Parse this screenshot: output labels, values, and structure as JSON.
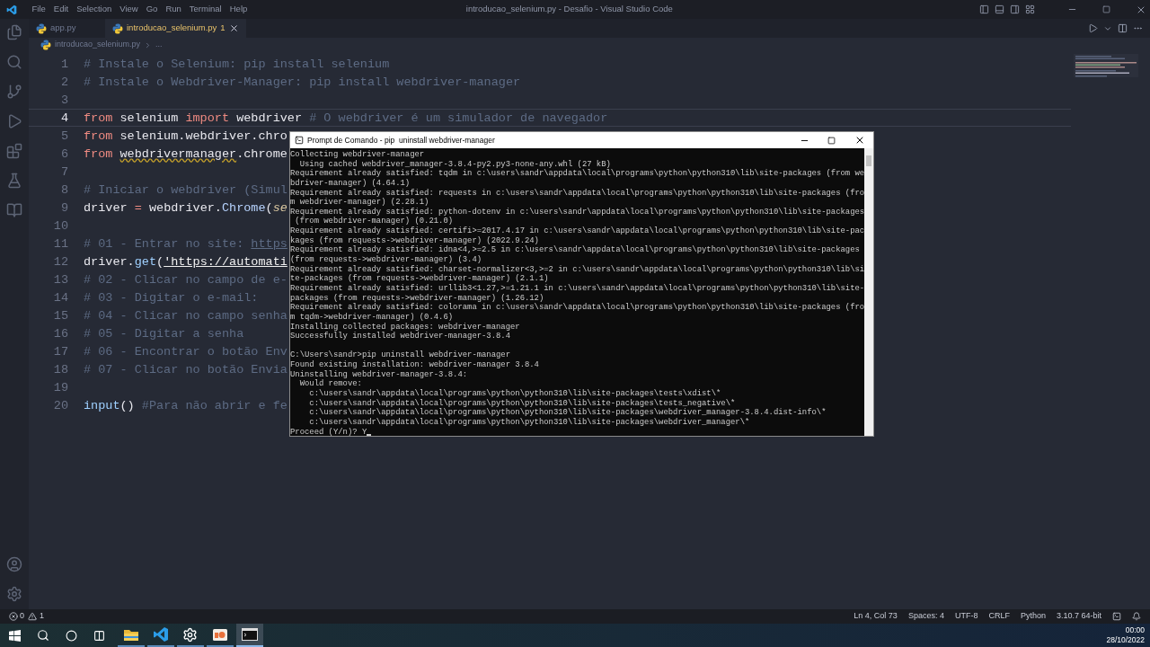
{
  "title_bar": {
    "menu": [
      "File",
      "Edit",
      "Selection",
      "View",
      "Go",
      "Run",
      "Terminal",
      "Help"
    ],
    "title": "introducao_selenium.py - Desafio - Visual Studio Code"
  },
  "tabs": [
    {
      "label": "app.py",
      "selected": false
    },
    {
      "label": "introducao_selenium.py",
      "badge": "1",
      "selected": true
    }
  ],
  "breadcrumb": {
    "file": "introducao_selenium.py",
    "rest": "..."
  },
  "editor": {
    "lines": [
      {
        "number": "1",
        "current": false,
        "tokens": [
          {
            "kind": "comment",
            "text": "# Instale o Selenium: pip install selenium"
          }
        ]
      },
      {
        "number": "2",
        "current": false,
        "tokens": [
          {
            "kind": "comment",
            "text": "# Instale o Webdriver-Manager: pip install webdriver-manager"
          }
        ]
      },
      {
        "number": "3",
        "current": false
      },
      {
        "number": "4",
        "current": true,
        "tokens": [
          {
            "kind": "keyword",
            "text": "from"
          },
          {
            "kind": "plain",
            "text": " selenium "
          },
          {
            "kind": "keyword",
            "text": "import"
          },
          {
            "kind": "plain",
            "text": " webdriver "
          },
          {
            "kind": "comment",
            "text": "# O webdriver é um simulador de navegador"
          }
        ]
      },
      {
        "number": "5",
        "current": false,
        "tokens": [
          {
            "kind": "keyword",
            "text": "from"
          },
          {
            "kind": "plain",
            "text": " selenium.webdriver.chro"
          }
        ]
      },
      {
        "number": "6",
        "current": false,
        "tokens": [
          {
            "kind": "keyword",
            "text": "from "
          },
          {
            "kind": "warning",
            "text": "webdrivermanager"
          },
          {
            "kind": "plain",
            "text": ".chrome"
          }
        ]
      },
      {
        "number": "7",
        "current": false
      },
      {
        "number": "8",
        "current": false,
        "tokens": [
          {
            "kind": "comment",
            "text": "# Iniciar o webdriver (Simul"
          }
        ]
      },
      {
        "number": "9",
        "current": false,
        "tokens": [
          {
            "kind": "plain",
            "text": "driver "
          },
          {
            "kind": "operator",
            "text": "="
          },
          {
            "kind": "plain",
            "text": " webdriver."
          },
          {
            "kind": "class",
            "text": "Chrome"
          },
          {
            "kind": "plain",
            "text": "("
          },
          {
            "kind": "param",
            "text": "se"
          }
        ]
      },
      {
        "number": "10",
        "current": false
      },
      {
        "number": "11",
        "current": false,
        "tokens": [
          {
            "kind": "comment",
            "text": "# 01 - Entrar no site: "
          },
          {
            "kind": "link",
            "text": "https"
          }
        ]
      },
      {
        "number": "12",
        "current": false,
        "tokens": [
          {
            "kind": "plain",
            "text": "driver."
          },
          {
            "kind": "func",
            "text": "get"
          },
          {
            "kind": "plain",
            "text": "("
          },
          {
            "kind": "string",
            "text": "'https://automati"
          }
        ]
      },
      {
        "number": "13",
        "current": false,
        "tokens": [
          {
            "kind": "comment",
            "text": "# 02 - Clicar no campo de e-"
          }
        ]
      },
      {
        "number": "14",
        "current": false,
        "tokens": [
          {
            "kind": "comment",
            "text": "# 03 - Digitar o e-mail:"
          }
        ]
      },
      {
        "number": "15",
        "current": false,
        "tokens": [
          {
            "kind": "comment",
            "text": "# 04 - Clicar no campo senha"
          }
        ]
      },
      {
        "number": "16",
        "current": false,
        "tokens": [
          {
            "kind": "comment",
            "text": "# 05 - Digitar a senha"
          }
        ]
      },
      {
        "number": "17",
        "current": false,
        "tokens": [
          {
            "kind": "comment",
            "text": "# 06 - Encontrar o botão Env"
          }
        ]
      },
      {
        "number": "18",
        "current": false,
        "tokens": [
          {
            "kind": "comment",
            "text": "# 07 - Clicar no botão Envia"
          }
        ]
      },
      {
        "number": "19",
        "current": false
      },
      {
        "number": "20",
        "current": false,
        "tokens": [
          {
            "kind": "func",
            "text": "input"
          },
          {
            "kind": "plain",
            "text": "() "
          },
          {
            "kind": "comment",
            "text": "#Para não abrir e fe"
          }
        ]
      }
    ]
  },
  "terminal": {
    "title": "Prompt de Comando - pip  uninstall webdriver-manager",
    "blocks": [
      [
        "Collecting webdriver-manager",
        "  Using cached webdriver_manager-3.8.4-py2.py3-none-any.whl (27 kB)",
        "Requirement already satisfied: tqdm in c:\\users\\sandr\\appdata\\local\\programs\\python\\python310\\lib\\site-packages (from we",
        "bdriver-manager) (4.64.1)",
        "Requirement already satisfied: requests in c:\\users\\sandr\\appdata\\local\\programs\\python\\python310\\lib\\site-packages (fro",
        "m webdriver-manager) (2.28.1)",
        "Requirement already satisfied: python-dotenv in c:\\users\\sandr\\appdata\\local\\programs\\python\\python310\\lib\\site-packages",
        " (from webdriver-manager) (0.21.0)",
        "Requirement already satisfied: certifi>=2017.4.17 in c:\\users\\sandr\\appdata\\local\\programs\\python\\python310\\lib\\site-pac",
        "kages (from requests->webdriver-manager) (2022.9.24)",
        "Requirement already satisfied: idna<4,>=2.5 in c:\\users\\sandr\\appdata\\local\\programs\\python\\python310\\lib\\site-packages",
        "(from requests->webdriver-manager) (3.4)",
        "Requirement already satisfied: charset-normalizer<3,>=2 in c:\\users\\sandr\\appdata\\local\\programs\\python\\python310\\lib\\si",
        "te-packages (from requests->webdriver-manager) (2.1.1)",
        "Requirement already satisfied: urllib3<1.27,>=1.21.1 in c:\\users\\sandr\\appdata\\local\\programs\\python\\python310\\lib\\site-",
        "packages (from requests->webdriver-manager) (1.26.12)",
        "Requirement already satisfied: colorama in c:\\users\\sandr\\appdata\\local\\programs\\python\\python310\\lib\\site-packages (fro",
        "m tqdm->webdriver-manager) (0.4.6)",
        "Installing collected packages: webdriver-manager",
        "Successfully installed webdriver-manager-3.8.4"
      ],
      [
        "C:\\Users\\sandr>pip uninstall webdriver-manager",
        "Found existing installation: webdriver-manager 3.8.4",
        "Uninstalling webdriver-manager-3.8.4:",
        "  Would remove:",
        "    c:\\users\\sandr\\appdata\\local\\programs\\python\\python310\\lib\\site-packages\\tests\\xdist\\*",
        "    c:\\users\\sandr\\appdata\\local\\programs\\python\\python310\\lib\\site-packages\\tests_negative\\*",
        "    c:\\users\\sandr\\appdata\\local\\programs\\python\\python310\\lib\\site-packages\\webdriver_manager-3.8.4.dist-info\\*",
        "    c:\\users\\sandr\\appdata\\local\\programs\\python\\python310\\lib\\site-packages\\webdriver_manager\\*"
      ]
    ],
    "prompt": "Proceed (Y/n)? Y"
  },
  "status_bar": {
    "errors": "0",
    "warnings": "1",
    "items": [
      "Ln 4, Col 73",
      "Spaces: 4",
      "UTF-8",
      "CRLF",
      "Python",
      "3.10.7 64-bit"
    ]
  },
  "taskbar": {
    "apps": [
      {
        "kind": "explorer",
        "selected": false
      },
      {
        "kind": "vscode",
        "selected": false
      },
      {
        "kind": "settings",
        "selected": false
      },
      {
        "kind": "photos",
        "selected": false
      },
      {
        "kind": "terminal",
        "selected": true
      }
    ],
    "time": "00:00",
    "date": "28/10/2022"
  }
}
